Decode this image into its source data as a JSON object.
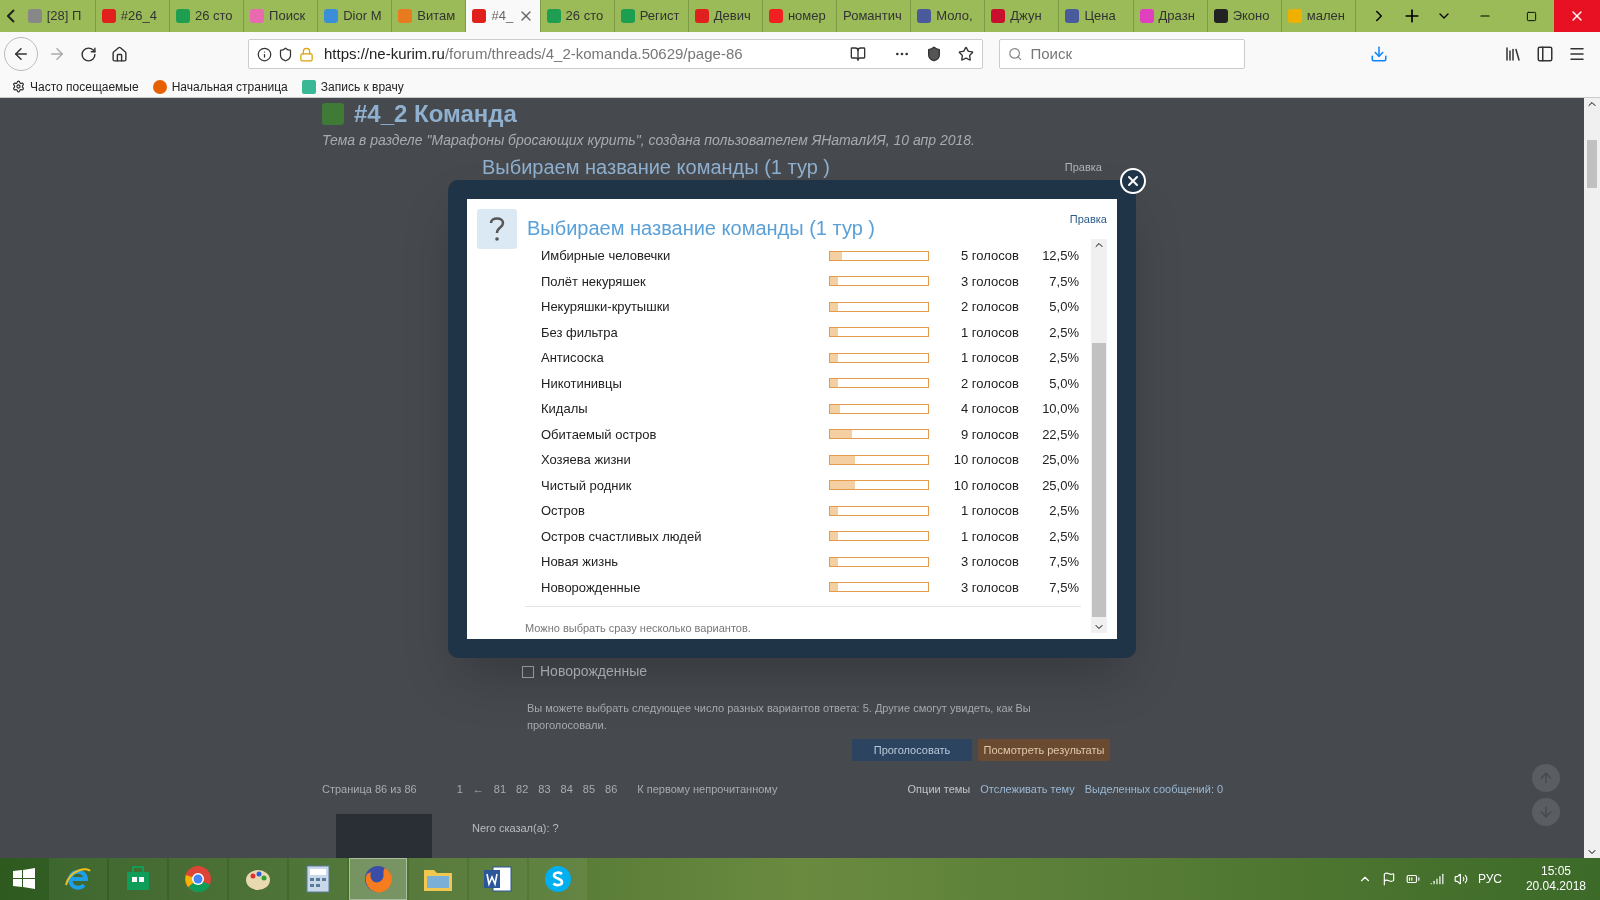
{
  "tabs": [
    {
      "label": "[28] П",
      "color": "#888888",
      "selected": false
    },
    {
      "label": "#26_4",
      "color": "#e0201c",
      "selected": false
    },
    {
      "label": "26 сто",
      "color": "#1e9e50",
      "selected": false
    },
    {
      "label": "Поиск",
      "color": "#e86ab0",
      "selected": false
    },
    {
      "label": "Dior M",
      "color": "#3a8fd8",
      "selected": false
    },
    {
      "label": "Витам",
      "color": "#e87a20",
      "selected": false
    },
    {
      "label": "#4_",
      "color": "#e0201c",
      "selected": true
    },
    {
      "label": "26 сто",
      "color": "#1e9e50",
      "selected": false
    },
    {
      "label": "Регист",
      "color": "#1e9e50",
      "selected": false
    },
    {
      "label": "Девич",
      "color": "#e0201c",
      "selected": false
    },
    {
      "label": "номер",
      "color": "#f02020",
      "selected": false
    },
    {
      "label": "Романтич",
      "selected": false
    },
    {
      "label": "Моло,",
      "color": "#4a5a9a",
      "selected": false
    },
    {
      "label": "Джун",
      "color": "#c8102e",
      "selected": false
    },
    {
      "label": "Цена",
      "color": "#4a5a9a",
      "selected": false
    },
    {
      "label": "Дразн",
      "color": "#e040c0",
      "selected": false
    },
    {
      "label": "Эконо",
      "color": "#222222",
      "selected": false
    },
    {
      "label": "мален",
      "color": "#f0b000",
      "selected": false
    }
  ],
  "url": {
    "host": "https://ne-kurim.ru",
    "path": "/forum/threads/4_2-komanda.50629/page-86"
  },
  "search": {
    "placeholder": "Поиск"
  },
  "bookmarks": [
    "Часто посещаемые",
    "Начальная страница",
    "Запись к врачу"
  ],
  "page": {
    "title": "#4_2 Команда",
    "subtitle": "Тема в разделе \"Марафоны бросающих курить\", создана пользователем ЯНаталИЯ, 10 апр 2018.",
    "edit": "Правка",
    "poll_title": "Выбираем название команды (1 тур )",
    "last_option": "Новорожденные",
    "checked": false,
    "note": "Вы можете выбрать следующее число разных вариантов ответа: 5. Другие смогут увидеть, как Вы проголосовали.",
    "vote": "Проголосовать",
    "results": "Посмотреть результаты",
    "pager_label": "Страница 86 из 86",
    "pages": [
      "1",
      "←",
      "81",
      "82",
      "83",
      "84",
      "85",
      "86"
    ],
    "unread": "К первому непрочитанному",
    "options": "Опции темы",
    "watch": "Отслеживать тему",
    "selected": "Выделенных сообщений: 0",
    "author": "Nero сказал(а): ?"
  },
  "modal": {
    "title": "Выбираем название команды (1 тур )",
    "edit": "Правка",
    "footer": "Можно выбрать сразу несколько вариантов.",
    "rows": [
      {
        "name": "Имбирные человечки",
        "level": 0.125,
        "votes": "5 голосов",
        "percent": "12,5%"
      },
      {
        "name": "Полёт некуряшек",
        "level": 0.075,
        "votes": "3 голосов",
        "percent": "7,5%"
      },
      {
        "name": "Некуряшки-крутышки",
        "level": 0.05,
        "votes": "2 голосов",
        "percent": "5,0%"
      },
      {
        "name": "Без фильтра",
        "level": 0.025,
        "votes": "1 голосов",
        "percent": "2,5%"
      },
      {
        "name": "Антисоска",
        "level": 0.025,
        "votes": "1 голосов",
        "percent": "2,5%"
      },
      {
        "name": "Никотинивцы",
        "level": 0.05,
        "votes": "2 голосов",
        "percent": "5,0%"
      },
      {
        "name": "Кидалы",
        "level": 0.1,
        "votes": "4 голосов",
        "percent": "10,0%"
      },
      {
        "name": "Обитаемый остров",
        "level": 0.225,
        "votes": "9 голосов",
        "percent": "22,5%"
      },
      {
        "name": "Хозяева жизни",
        "level": 0.25,
        "votes": "10 голосов",
        "percent": "25,0%"
      },
      {
        "name": "Чистый родник",
        "level": 0.25,
        "votes": "10 голосов",
        "percent": "25,0%"
      },
      {
        "name": "Остров",
        "level": 0.025,
        "votes": "1 голосов",
        "percent": "2,5%"
      },
      {
        "name": "Остров счастливых людей",
        "level": 0.025,
        "votes": "1 голосов",
        "percent": "2,5%"
      },
      {
        "name": "Новая жизнь",
        "level": 0.075,
        "votes": "3 голосов",
        "percent": "7,5%"
      },
      {
        "name": "Новорожденные",
        "level": 0.075,
        "votes": "3 голосов",
        "percent": "7,5%"
      }
    ]
  },
  "taskbar": {
    "apps": [
      {
        "kind": "ie",
        "active": false
      },
      {
        "kind": "store",
        "active": false
      },
      {
        "kind": "chrome",
        "active": false
      },
      {
        "kind": "paint",
        "active": false
      },
      {
        "kind": "calc",
        "active": false
      },
      {
        "kind": "firefox",
        "active": true
      },
      {
        "kind": "explorer",
        "active": false
      },
      {
        "kind": "word",
        "active": false
      },
      {
        "kind": "skype",
        "active": false
      }
    ],
    "lang": "РУС",
    "time": "15:05",
    "date": "20.04.2018"
  }
}
